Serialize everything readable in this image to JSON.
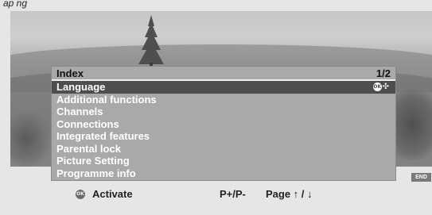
{
  "top_caption": "ap   ng",
  "menu": {
    "title": "Index",
    "page": "1/2",
    "items": [
      "Language",
      "Additional functions",
      "Channels",
      "Connections",
      "Integrated features",
      "Parental lock",
      "Picture Setting",
      "Programme info"
    ],
    "selected_index": 0,
    "ok_glyph": "OK",
    "nav_glyph": "✣"
  },
  "end_label": "END",
  "footer": {
    "ok_glyph": "OK",
    "activate": "Activate",
    "p_plus_minus": "P+/P-",
    "page": "Page ↑ / ↓"
  },
  "colors": {
    "menu_bg": "#a9a9a9",
    "selected_bg": "#4e4e4e",
    "page_bg": "#e6e6e6"
  }
}
